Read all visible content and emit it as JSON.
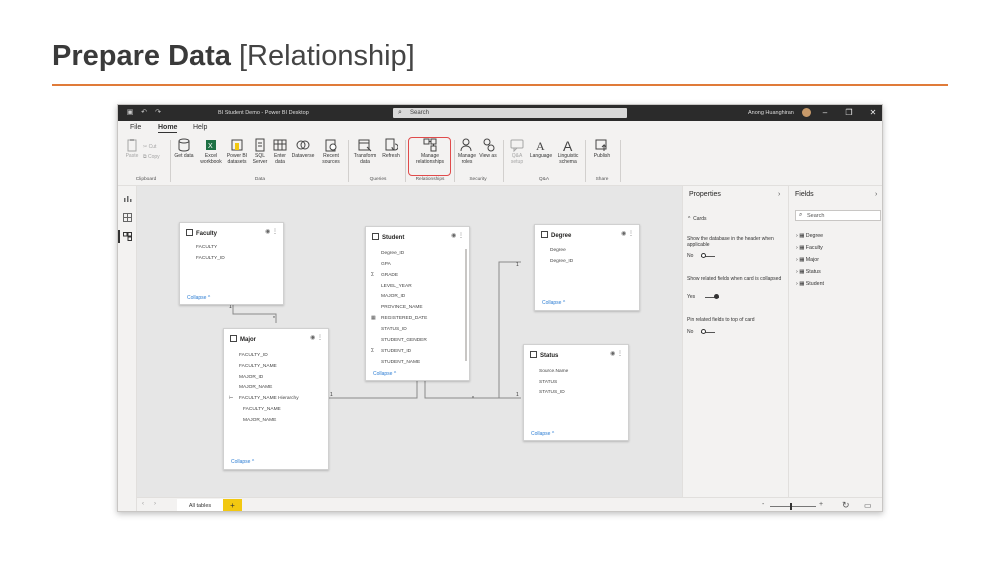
{
  "slide": {
    "title_bold": "Prepare Data",
    "title_rest": "[Relationship]"
  },
  "window": {
    "title": "BI Student Demo - Power BI Desktop",
    "search_placeholder": "Search",
    "user": "Anong Huanghiran"
  },
  "menu": [
    "File",
    "Home",
    "Help"
  ],
  "ribbon": {
    "clipboard": {
      "paste": "Paste",
      "cut": "Cut",
      "copy": "Copy",
      "group": "Clipboard"
    },
    "data": {
      "get_data": "Get data",
      "excel": "Excel workbook",
      "pbi": "Power BI datasets",
      "sql": "SQL Server",
      "enter": "Enter data",
      "dataverse": "Dataverse",
      "recent": "Recent sources",
      "group": "Data"
    },
    "queries": {
      "transform": "Transform data",
      "refresh": "Refresh",
      "group": "Queries"
    },
    "relationships": {
      "manage": "Manage relationships",
      "group": "Relationships"
    },
    "security": {
      "roles": "Manage roles",
      "viewas": "View as",
      "group": "Security"
    },
    "qa": {
      "setup": "Q&A setup",
      "language": "Language",
      "schema": "Linguistic schema",
      "group": "Q&A"
    },
    "share": {
      "publish": "Publish",
      "group": "Share"
    }
  },
  "tables": {
    "faculty": {
      "name": "Faculty",
      "fields": [
        "FACULTY",
        "FACULTY_ID"
      ],
      "collapse": "Collapse"
    },
    "student": {
      "name": "Student",
      "fields": [
        "Degree_ID",
        "GPA",
        "GRADE",
        "LEVEL_YEAR",
        "MAJOR_ID",
        "PROVINCE_NAME",
        "REGISTERED_DATE",
        "STATUS_ID",
        "STUDENT_GENDER",
        "STUDENT_ID",
        "STUDENT_NAME"
      ],
      "collapse": "Collapse"
    },
    "degree": {
      "name": "Degree",
      "fields": [
        "Degree",
        "Degree_ID"
      ],
      "collapse": "Collapse"
    },
    "major": {
      "name": "Major",
      "fields": [
        "FACULTY_ID",
        "FACULTY_NAME",
        "MAJOR_ID",
        "MAJOR_NAME",
        "FACULTY_NAME Hierarchy",
        "FACULTY_NAME",
        "MAJOR_NAME"
      ],
      "collapse": "Collapse"
    },
    "status": {
      "name": "Status",
      "fields": [
        "Source.Name",
        "STATUS",
        "STATUS_ID"
      ],
      "collapse": "Collapse"
    }
  },
  "cardinality": {
    "one": "1",
    "many": "*"
  },
  "tabs": {
    "all_tables": "All tables",
    "add": "+"
  },
  "properties": {
    "title": "Properties",
    "section": "Cards",
    "opt1": "Show the database in the header when applicable",
    "opt1_val": "No",
    "opt2": "Show related fields when card is collapsed",
    "opt2_val": "Yes",
    "opt3": "Pin related fields to top of card",
    "opt3_val": "No"
  },
  "fields_pane": {
    "title": "Fields",
    "search": "Search",
    "items": [
      "Degree",
      "Faculty",
      "Major",
      "Status",
      "Student"
    ]
  },
  "status": {
    "zoom_minus": "-",
    "zoom_plus": "+"
  }
}
